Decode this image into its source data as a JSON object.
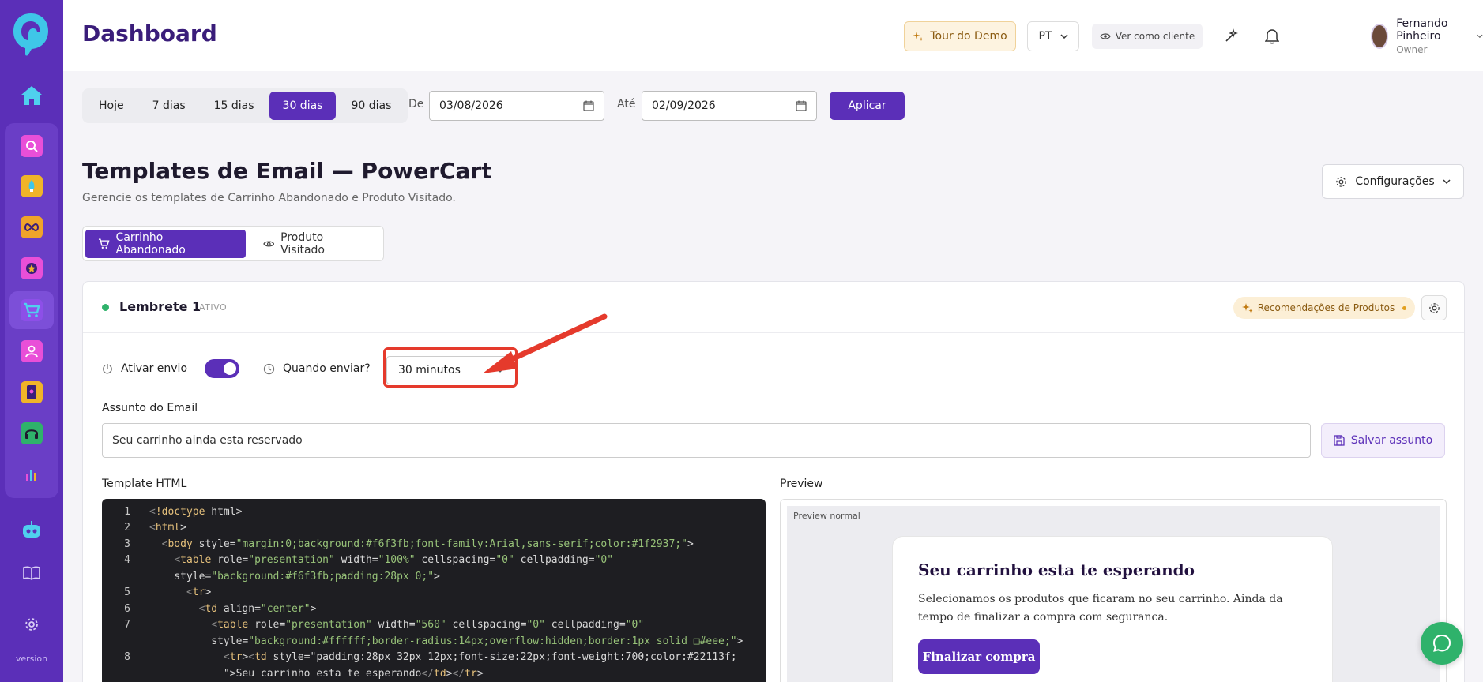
{
  "header": {
    "title": "Dashboard",
    "tour_label": "Tour do Demo",
    "lang": "PT",
    "view_as_client": "Ver como cliente",
    "user_name": "Fernando Pinheiro",
    "user_role": "Owner"
  },
  "sidebar": {
    "version": "version",
    "items": [
      "search-app-icon",
      "rocket-app-icon",
      "infinity-app-icon",
      "star-app-icon",
      "cart-app-icon",
      "person-app-icon",
      "phone-app-icon",
      "headset-app-icon",
      "chart-app-icon"
    ]
  },
  "filter": {
    "ranges": [
      "Hoje",
      "7 dias",
      "15 dias",
      "30 dias",
      "90 dias"
    ],
    "active_range": "30 dias",
    "from_label": "De",
    "from_value": "03/08/2026",
    "to_label": "Até",
    "to_value": "02/09/2026",
    "apply_label": "Aplicar"
  },
  "section": {
    "title": "Templates de Email — PowerCart",
    "subtitle": "Gerencie os templates de Carrinho Abandonado e Produto Visitado.",
    "config_label": "Configurações",
    "tabs": [
      "Carrinho Abandonado",
      "Produto Visitado"
    ]
  },
  "reminder": {
    "title": "Lembrete 1",
    "status": "ATIVO",
    "reco_badge": "Recomendações de Produtos",
    "send_label": "Ativar envio",
    "send_enabled": true,
    "when_label": "Quando enviar?",
    "when_value": "30 minutos",
    "subject_label": "Assunto do Email",
    "subject_value": "Seu carrinho ainda esta reservado",
    "save_subject_label": "Salvar assunto",
    "template_label": "Template HTML",
    "preview_label": "Preview"
  },
  "code_lines": [
    {
      "num": "1",
      "text": "<!doctype html>"
    },
    {
      "num": "2",
      "text": "<html>"
    },
    {
      "num": "3",
      "text": "  <body style=\"margin:0;background:#f6f3fb;font-family:Arial,sans-serif;color:#1f2937;\">"
    },
    {
      "num": "4",
      "text": "    <table role=\"presentation\" width=\"100%\" cellspacing=\"0\" cellpadding=\"0\""
    },
    {
      "num": "",
      "text": "    style=\"background:#f6f3fb;padding:28px 0;\">"
    },
    {
      "num": "5",
      "text": "      <tr>"
    },
    {
      "num": "6",
      "text": "        <td align=\"center\">"
    },
    {
      "num": "7",
      "text": "          <table role=\"presentation\" width=\"560\" cellspacing=\"0\" cellpadding=\"0\""
    },
    {
      "num": "",
      "text": "          style=\"background:#ffffff;border-radius:14px;overflow:hidden;border:1px solid □#eee;\">"
    },
    {
      "num": "8",
      "text": "            <tr><td style=\"padding:28px 32px 12px;font-size:22px;font-weight:700;color:#22113f;"
    },
    {
      "num": "",
      "text": "            \">Seu carrinho esta te esperando</td></tr>"
    }
  ],
  "preview": {
    "tag": "Preview normal",
    "mail_title": "Seu carrinho esta te esperando",
    "mail_text": "Selecionamos os produtos que ficaram no seu carrinho. Ainda da tempo de finalizar a compra com seguranca.",
    "mail_button": "Finalizar compra"
  },
  "colors": {
    "brand": "#5b2fb8",
    "success": "#2fb26b",
    "annotation": "#e53a2c"
  }
}
